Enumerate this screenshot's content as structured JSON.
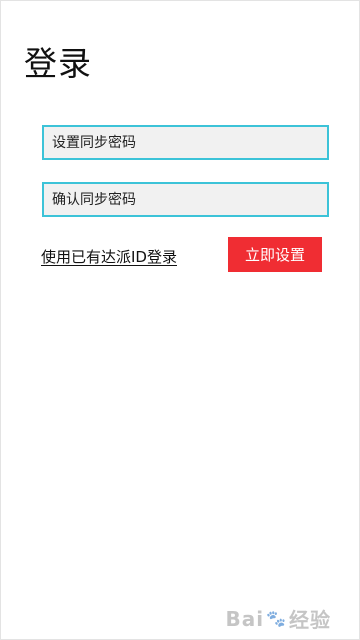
{
  "page": {
    "title": "登录"
  },
  "form": {
    "password_field": {
      "placeholder": "设置同步密码",
      "value": ""
    },
    "confirm_field": {
      "placeholder": "确认同步密码",
      "value": ""
    },
    "existing_id_link": "使用已有达派ID登录",
    "submit_button": "立即设置"
  },
  "watermark": {
    "text_left": "Bai",
    "text_right": "经验"
  },
  "colors": {
    "accent_border": "#3cc3d8",
    "button_bg": "#f02d33",
    "field_bg": "#f1f1f1"
  }
}
